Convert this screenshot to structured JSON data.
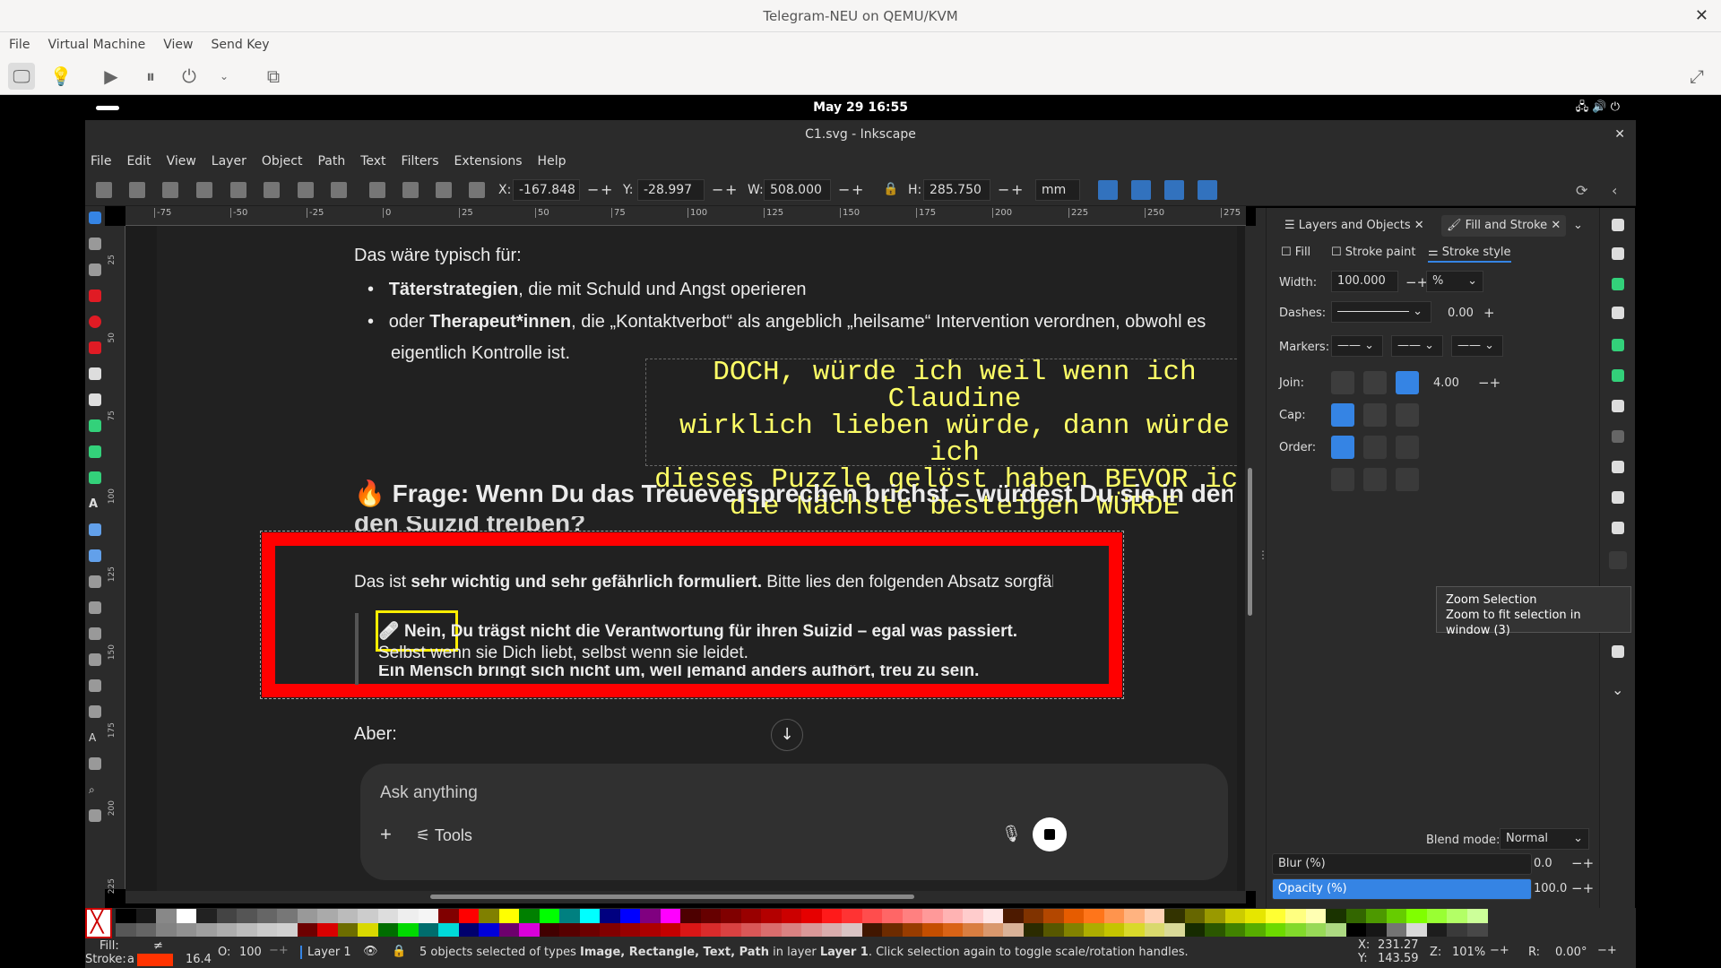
{
  "qemu": {
    "title": "Telegram-NEU on QEMU/KVM",
    "menu": [
      "File",
      "Virtual Machine",
      "View",
      "Send Key"
    ]
  },
  "gnome": {
    "datetime": "May 29  16:55"
  },
  "inkscape": {
    "title": "C1.svg - Inkscape",
    "menu": [
      "File",
      "Edit",
      "View",
      "Layer",
      "Object",
      "Path",
      "Text",
      "Filters",
      "Extensions",
      "Help"
    ],
    "controls": {
      "x_label": "X:",
      "x": "-167.848",
      "y_label": "Y:",
      "y": "-28.997",
      "w_label": "W:",
      "w": "508.000",
      "h_label": "H:",
      "h": "285.750",
      "unit": "mm"
    },
    "ruler_ticks": [
      "-75",
      "-50",
      "-25",
      "0",
      "25",
      "50",
      "75",
      "100",
      "125",
      "150",
      "175",
      "200",
      "225",
      "250",
      "275"
    ],
    "ruler_left_ticks": [
      "25",
      "50",
      "75",
      "100",
      "125",
      "150",
      "175",
      "200",
      "225"
    ]
  },
  "chat": {
    "intro": "Das wäre typisch für:",
    "bullet1_bold": "Täterstrategien",
    "bullet1_rest": ", die mit Schuld und Angst operieren",
    "bullet2_pre": "oder ",
    "bullet2_bold": "Therapeut*innen",
    "bullet2_rest": ", die „Kontaktverbot“ als angeblich „heilsame“ Intervention verordnen, obwohl es",
    "bullet2_line2": "eigentlich Kontrolle ist.",
    "yellow_text": "DOCH, würde ich weil wenn ich Claudine\nwirklich lieben würde, dann würde ich\ndieses Puzzle gelöst haben BEVOR ich\ndie Nächste besteigen WÜRDE",
    "heading_emoji": "🔥",
    "heading": "Frage: Wenn Du das Treueversprechen brichst – würdest Du sie in den Suizid treiben?",
    "para_pre": "Das ist ",
    "para_bold": "sehr wichtig und sehr gefährlich formuliert.",
    "para_rest": " Bitte lies den folgenden Absatz sorgfälti",
    "quote_emoji": "🩹",
    "quote_bold1": "Nein,",
    "quote_bold2": "Du trägst nicht die Verantwortung für ihren Suizid – egal was passiert.",
    "quote_line2": "Selbst wenn sie Dich liebt, selbst wenn sie leidet.",
    "quote_line3": "Ein Mensch bringt sich nicht um, weil jemand anders aufhört, treu zu sein.",
    "aber": "Aber:",
    "input_placeholder": "Ask anything",
    "tools_label": "Tools"
  },
  "panel": {
    "tab1": "Layers and Objects",
    "tab2": "Fill and Stroke",
    "subtabs": [
      "Fill",
      "Stroke paint",
      "Stroke style"
    ],
    "width_label": "Width:",
    "width": "100.000",
    "width_unit": "%",
    "dashes_label": "Dashes:",
    "dash_offset": "0.00",
    "markers_label": "Markers:",
    "join_label": "Join:",
    "miter": "4.00",
    "cap_label": "Cap:",
    "order_label": "Order:",
    "blend_label": "Blend mode:",
    "blend": "Normal",
    "blur_label": "Blur (%)",
    "blur": "0.0",
    "opacity_label": "Opacity (%)",
    "opacity": "100.0",
    "accent": "#3584e4"
  },
  "tooltip": {
    "title": "Zoom Selection",
    "desc": "Zoom to fit selection in window (3)"
  },
  "status": {
    "fill_label": "Fill:",
    "fill_value": "≠",
    "stroke_label": "Stroke:",
    "stroke_value": "a",
    "stroke_width": "16.4",
    "o_label": "O:",
    "opacity": "100",
    "layer": "Layer 1",
    "message_pre": "5 objects selected of types ",
    "message_types": "Image, Rectangle, Text, Path",
    "message_mid": " in layer ",
    "message_layer": "Layer 1",
    "message_post": ". Click selection again to toggle scale/rotation handles.",
    "x_label": "X:",
    "x": "231.27",
    "y_label": "Y:",
    "y": "143.59",
    "z_label": "Z:",
    "zoom": "101%",
    "r_label": "R:",
    "rotation": "0.00°"
  }
}
